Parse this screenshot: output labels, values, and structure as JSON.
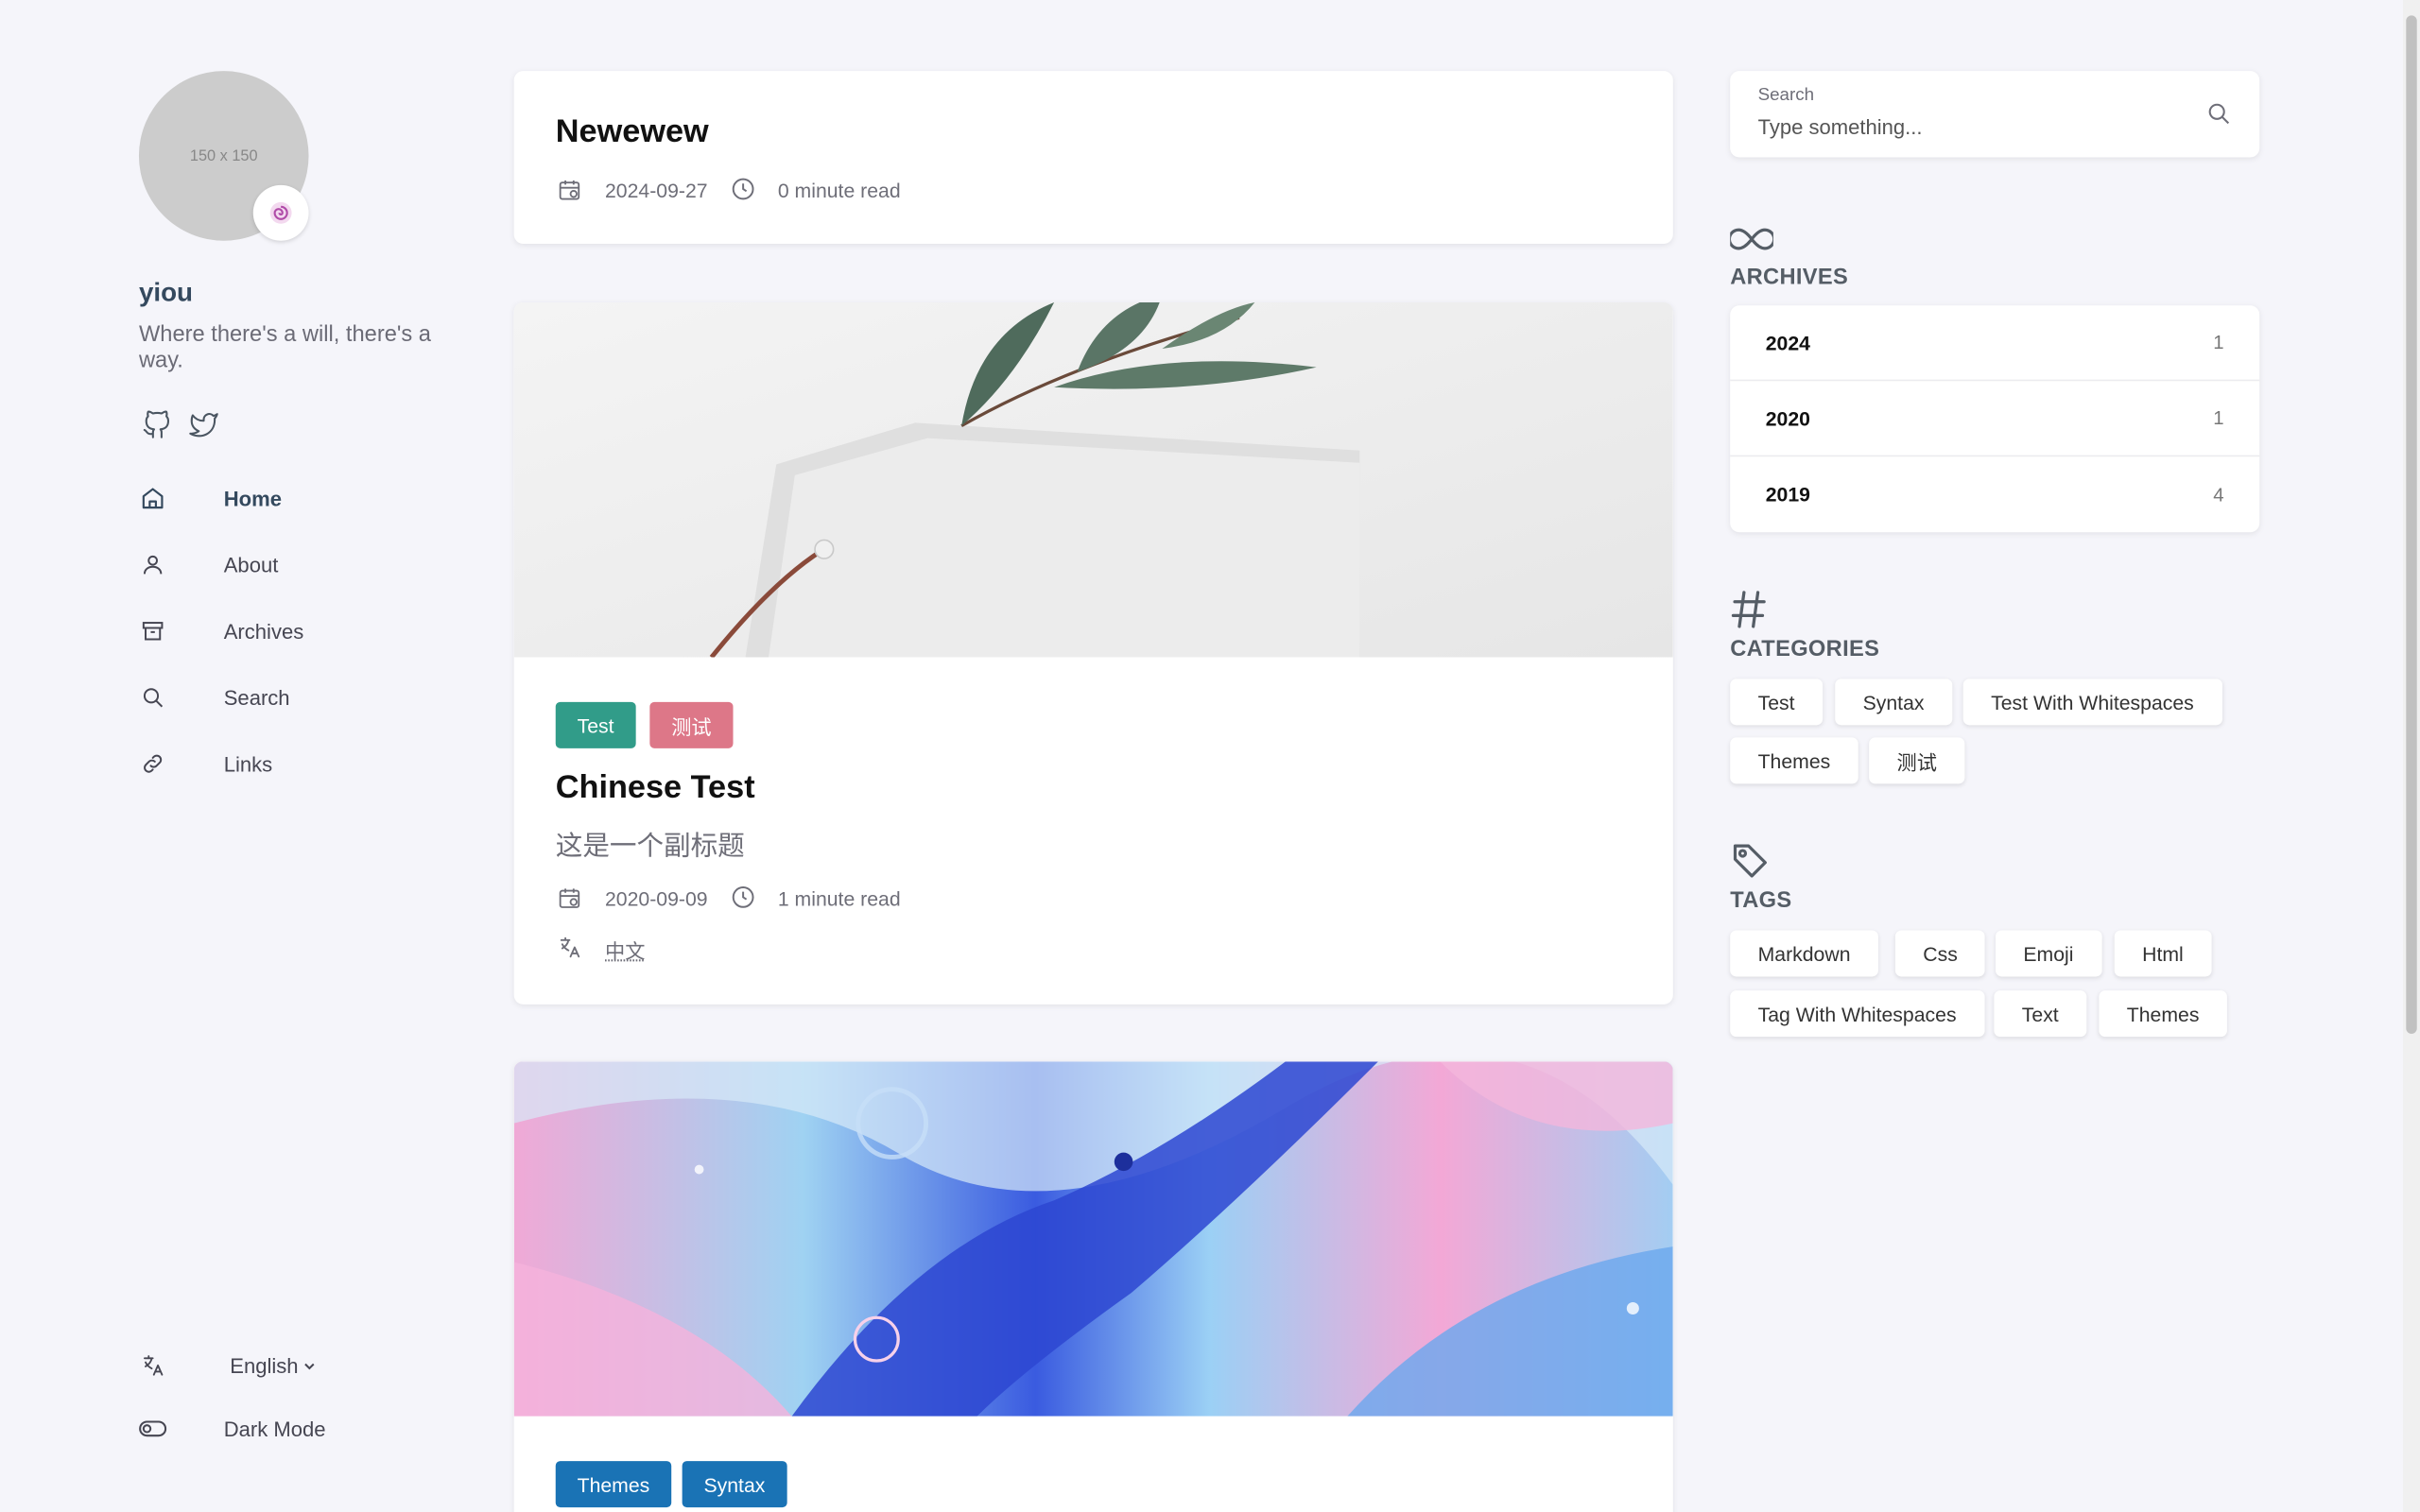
{
  "profile": {
    "avatar_placeholder": "150 x 150",
    "name": "yiou",
    "bio": "Where there's a will, there's a way.",
    "social": [
      "github-icon",
      "twitter-icon"
    ]
  },
  "nav": {
    "items": [
      {
        "label": "Home",
        "icon": "home-icon"
      },
      {
        "label": "About",
        "icon": "user-icon"
      },
      {
        "label": "Archives",
        "icon": "archive-icon"
      },
      {
        "label": "Search",
        "icon": "search-icon"
      },
      {
        "label": "Links",
        "icon": "link-icon"
      }
    ],
    "language_label": "English",
    "dark_mode_label": "Dark Mode"
  },
  "posts": [
    {
      "title": "Newewew",
      "date": "2024-09-27",
      "read_time": "0 minute read"
    },
    {
      "categories": [
        {
          "label": "Test",
          "color": "#319c89"
        },
        {
          "label": "测试",
          "color": "#dd7788"
        }
      ],
      "title": "Chinese Test",
      "subtitle": "这是一个副标题",
      "date": "2020-09-09",
      "read_time": "1 minute read",
      "language": "中文"
    },
    {
      "categories": [
        {
          "label": "Themes",
          "color": "#1a73b5"
        },
        {
          "label": "Syntax",
          "color": "#1a73b5"
        }
      ]
    }
  ],
  "search": {
    "label": "Search",
    "placeholder": "Type something..."
  },
  "archives": {
    "title": "ARCHIVES",
    "rows": [
      {
        "year": "2024",
        "count": "1"
      },
      {
        "year": "2020",
        "count": "1"
      },
      {
        "year": "2019",
        "count": "4"
      }
    ]
  },
  "categories": {
    "title": "CATEGORIES",
    "items": [
      "Test",
      "Syntax",
      "Test With Whitespaces",
      "Themes",
      "测试"
    ]
  },
  "tags": {
    "title": "TAGS",
    "items": [
      "Markdown",
      "Css",
      "Emoji",
      "Html",
      "Tag With Whitespaces",
      "Text",
      "Themes"
    ]
  }
}
